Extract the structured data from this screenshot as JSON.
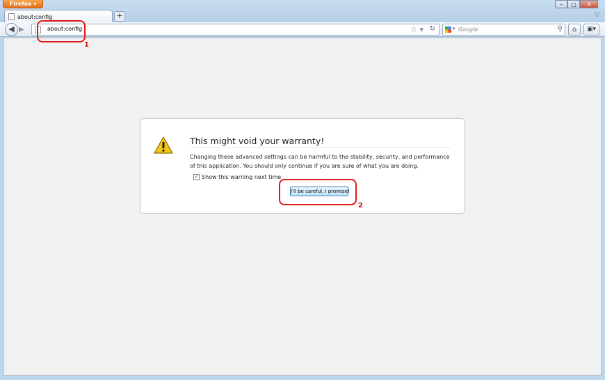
{
  "browser": {
    "menu_button_label": "Firefox",
    "tab_title": "about:config",
    "url": "about:config",
    "search_placeholder": "Google"
  },
  "icons": {
    "back": "back-arrow-icon",
    "forward": "forward-arrow-icon",
    "bookmark": "star-icon",
    "reload": "reload-icon",
    "search_engine": "google-icon",
    "search": "magnifier-icon",
    "home": "home-icon",
    "addons": "addon-bar-icon",
    "warning": "warning-triangle-icon"
  },
  "dialog": {
    "title": "This might void your warranty!",
    "body": "Changing these advanced settings can be harmful to the stability, security, and performance of this application. You should only continue if you are sure of what you are doing.",
    "checkbox_label": "Show this warning next time",
    "checkbox_checked": true,
    "confirm_button_label": "I'll be careful, I promise!"
  },
  "annotations": {
    "first_label": "1",
    "second_label": "2"
  },
  "colors": {
    "annotation_red": "#e01818",
    "firefox_orange": "#e8731c"
  }
}
